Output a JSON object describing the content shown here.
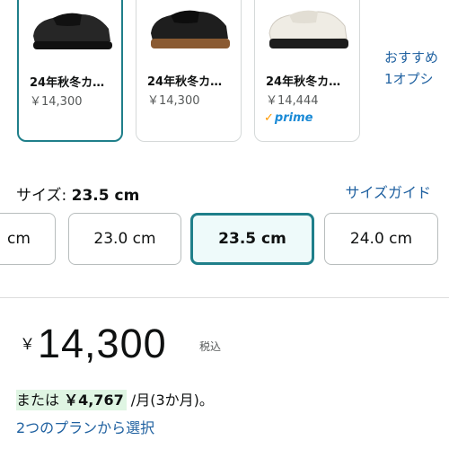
{
  "variants": [
    {
      "title": "24年秋冬カ…",
      "price": "￥14,300",
      "color": "#1c1c1c",
      "sole": "#1c1c1c",
      "selected": true
    },
    {
      "title": "24年秋冬カ…",
      "price": "￥14,300",
      "color": "#1c1c1c",
      "sole": "#8a5a32",
      "selected": false
    },
    {
      "title": "24年秋冬カ…",
      "price": "￥14,444",
      "color": "#efece4",
      "sole": "#1c1c1c",
      "selected": false,
      "prime": "prime"
    }
  ],
  "more_options": {
    "line1": "おすすめ",
    "line2": "1オプシ"
  },
  "size": {
    "label": "サイズ: ",
    "value": "23.5 cm",
    "guide_link": "サイズガイド"
  },
  "size_options": [
    "cm",
    "23.0 cm",
    "23.5 cm",
    "24.0 cm"
  ],
  "selected_size": "23.5 cm",
  "price": {
    "currency": "￥",
    "amount": "14,300",
    "tax_note": "税込"
  },
  "installment": {
    "prefix": "または ",
    "amount": "￥4,767",
    "suffix": " /月(3か月)。"
  },
  "plans_link": "2つのプランから選択",
  "colors": {
    "accent": "#1f7f8a",
    "link": "#2162a1",
    "highlight": "#dff5e3"
  }
}
